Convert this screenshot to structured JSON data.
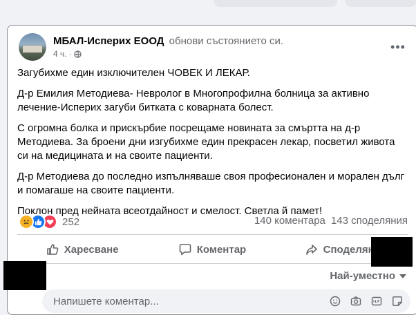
{
  "post": {
    "page_name": "МБАЛ-Исперих ЕООД",
    "action_text": "обнови състоянието си.",
    "time": "4 ч.",
    "dot": "·",
    "more_label": "•••",
    "paragraphs": [
      "Загубихме един изключителен ЧОВЕК И ЛЕКАР.",
      "Д-р Емилия Методиева- Невролог в Многопрофилна болница за активно лечение-Исперих загуби битката с коварната болест.",
      "С огромна болка и прискърбие посрещаме новината за смъртта на д-р Методиева. За броени дни изгубихме един прекрасен лекар, посветил живота си на медицината и на своите пациенти.",
      "Д-р Методиева до последно  изпълняваше своя професионален и морален дълг и помагаше на своите пациенти.",
      "Поклон пред нейната всеотдайност и смелост. Светла й памет!"
    ]
  },
  "reactions": {
    "icons": [
      "sad-icon",
      "like-icon",
      "love-icon"
    ],
    "count": "252",
    "comments": "140 коментара",
    "shares": "143 споделяния"
  },
  "actions": {
    "like": "Харесване",
    "comment": "Коментар",
    "share": "Споделяне"
  },
  "comments": {
    "sort_label": "Най-уместно",
    "placeholder": "Напишете коментар..."
  },
  "colors": {
    "brand_blue": "#1877f2",
    "secondary_text": "#65676b",
    "sad": "#f7b125",
    "love": "#f33e58"
  }
}
